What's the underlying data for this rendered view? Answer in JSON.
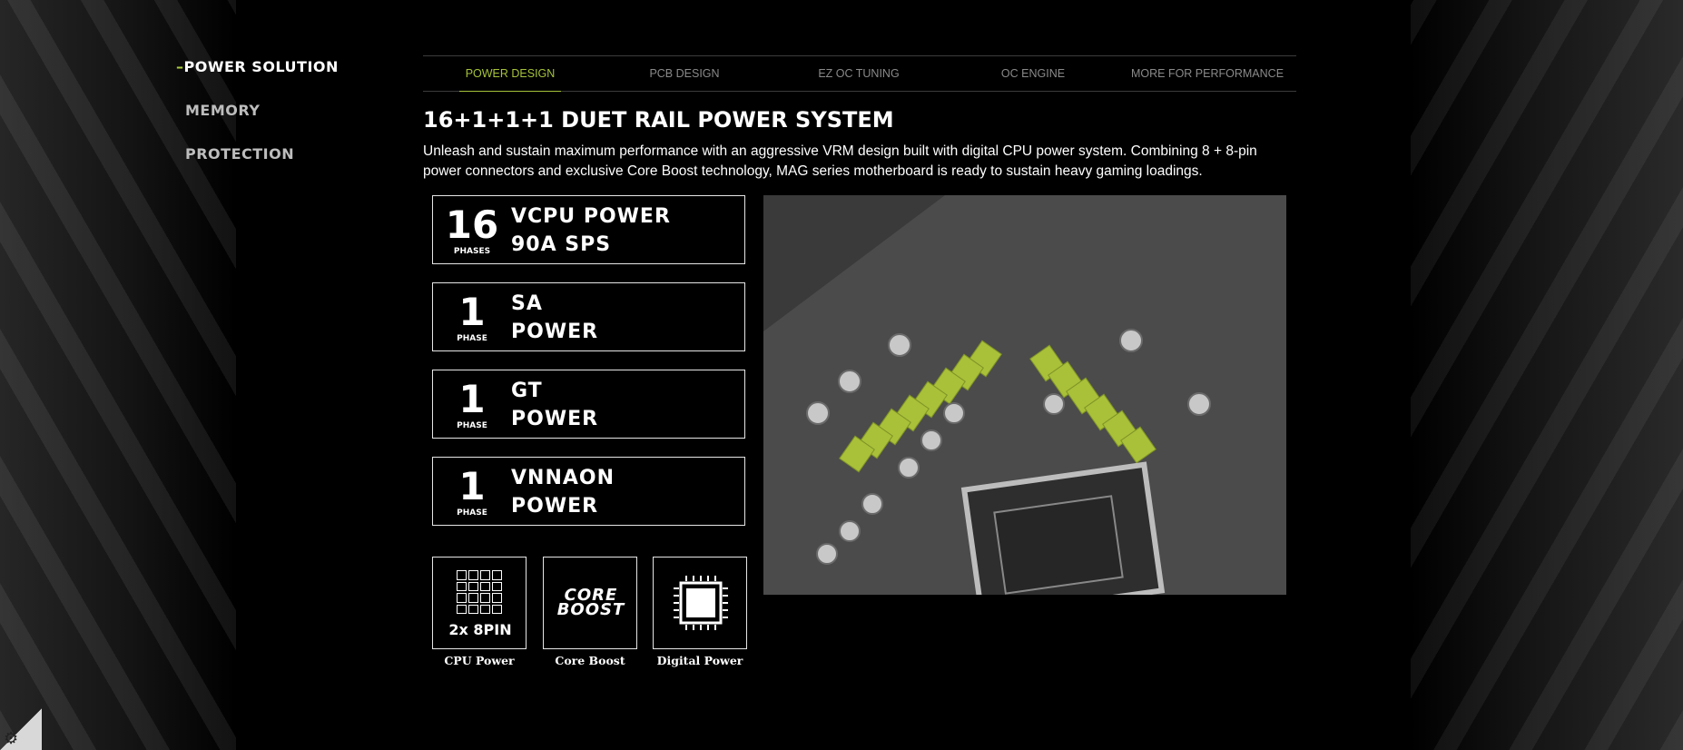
{
  "sidenav": {
    "dash": "–",
    "items": [
      {
        "label": "POWER SOLUTION"
      },
      {
        "label": "MEMORY"
      },
      {
        "label": "PROTECTION"
      }
    ]
  },
  "tabs": [
    {
      "label": "POWER DESIGN"
    },
    {
      "label": "PCB DESIGN"
    },
    {
      "label": "EZ OC TUNING"
    },
    {
      "label": "OC ENGINE"
    },
    {
      "label": "MORE FOR PERFORMANCE"
    }
  ],
  "content": {
    "title": "16+1+1+1 DUET RAIL POWER SYSTEM",
    "description": "Unleash and sustain maximum performance with an aggressive VRM design built with digital CPU power system. Combining 8 + 8-pin power connectors and exclusive Core Boost technology, MAG series motherboard is ready to sustain heavy gaming loadings."
  },
  "phases": [
    {
      "num": "16",
      "unit": "PHASES",
      "line1": "VCPU  POWER",
      "line2": "90A  SPS"
    },
    {
      "num": "1",
      "unit": "PHASE",
      "line1": "SA",
      "line2": "POWER"
    },
    {
      "num": "1",
      "unit": "PHASE",
      "line1": "GT",
      "line2": "POWER"
    },
    {
      "num": "1",
      "unit": "PHASE",
      "line1": "VNNAON",
      "line2": "POWER"
    }
  ],
  "features": [
    {
      "label": "CPU Power",
      "icon": "8-pin-connector-icon",
      "icon_text": "2x 8PIN"
    },
    {
      "label": "Core Boost",
      "icon": "core-boost-icon",
      "icon_line1": "CORE",
      "icon_line2": "BOOST"
    },
    {
      "label": "Digital Power",
      "icon": "chip-icon"
    }
  ],
  "colors": {
    "accent": "#a5c23a",
    "background": "#000000"
  }
}
